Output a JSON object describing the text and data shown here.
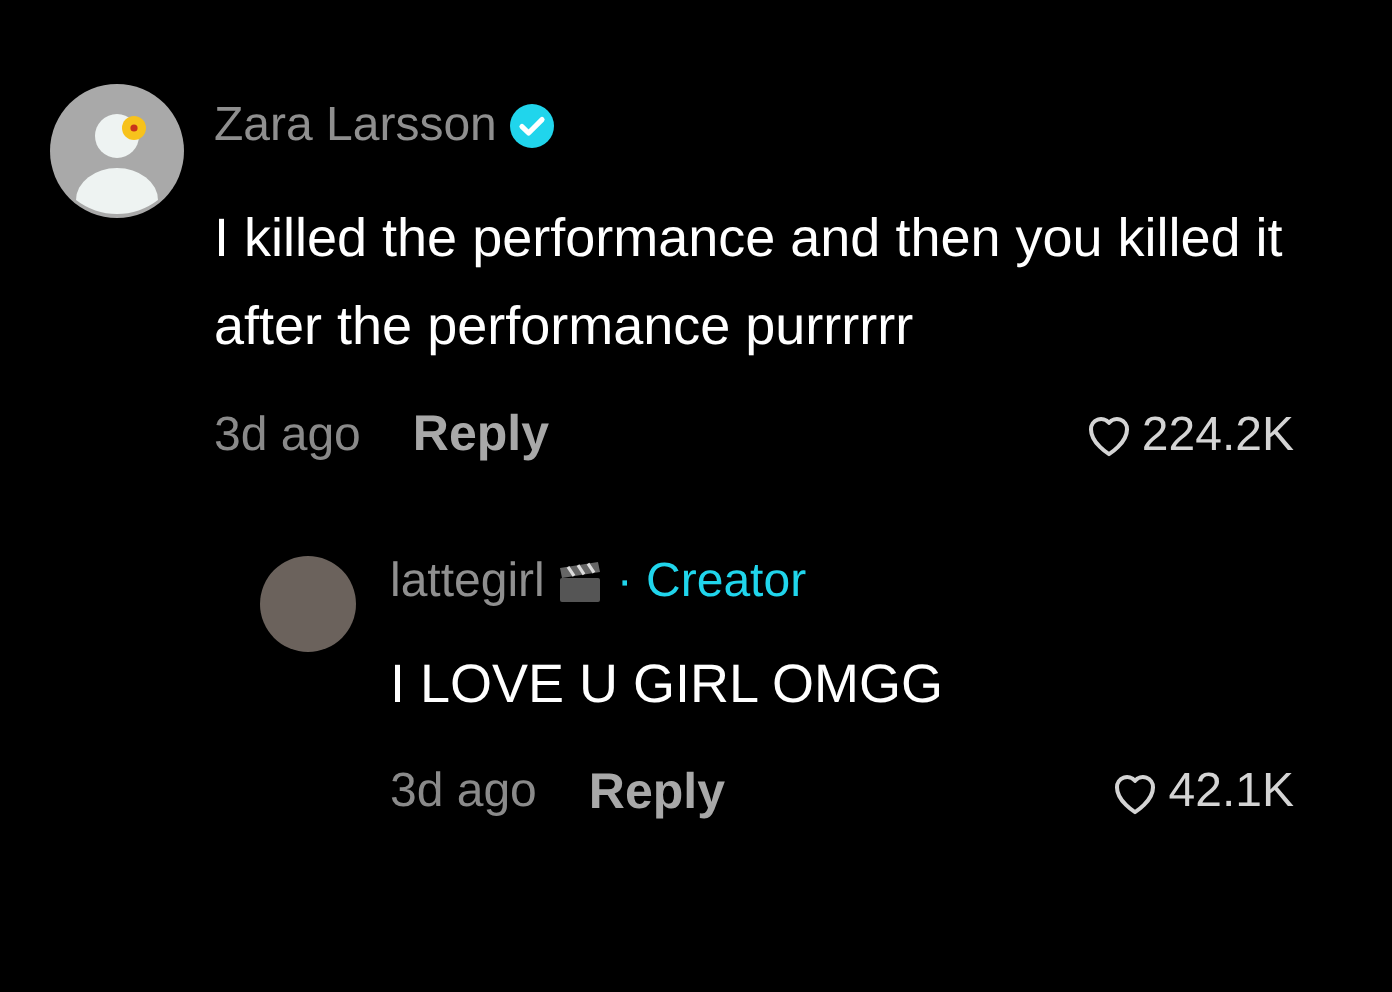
{
  "comment": {
    "author": "Zara Larsson",
    "verified": true,
    "text": "I killed the performance and then you killed it after the performance purrrrrr",
    "time": "3d ago",
    "reply_label": "Reply",
    "likes": "224.2K",
    "liked": false
  },
  "replies": [
    {
      "author": "lattegirl",
      "badge": "· Creator",
      "text": "I LOVE U GIRL OMGG",
      "time": "3d ago",
      "reply_label": "Reply",
      "likes": "42.1K",
      "liked": false
    }
  ]
}
